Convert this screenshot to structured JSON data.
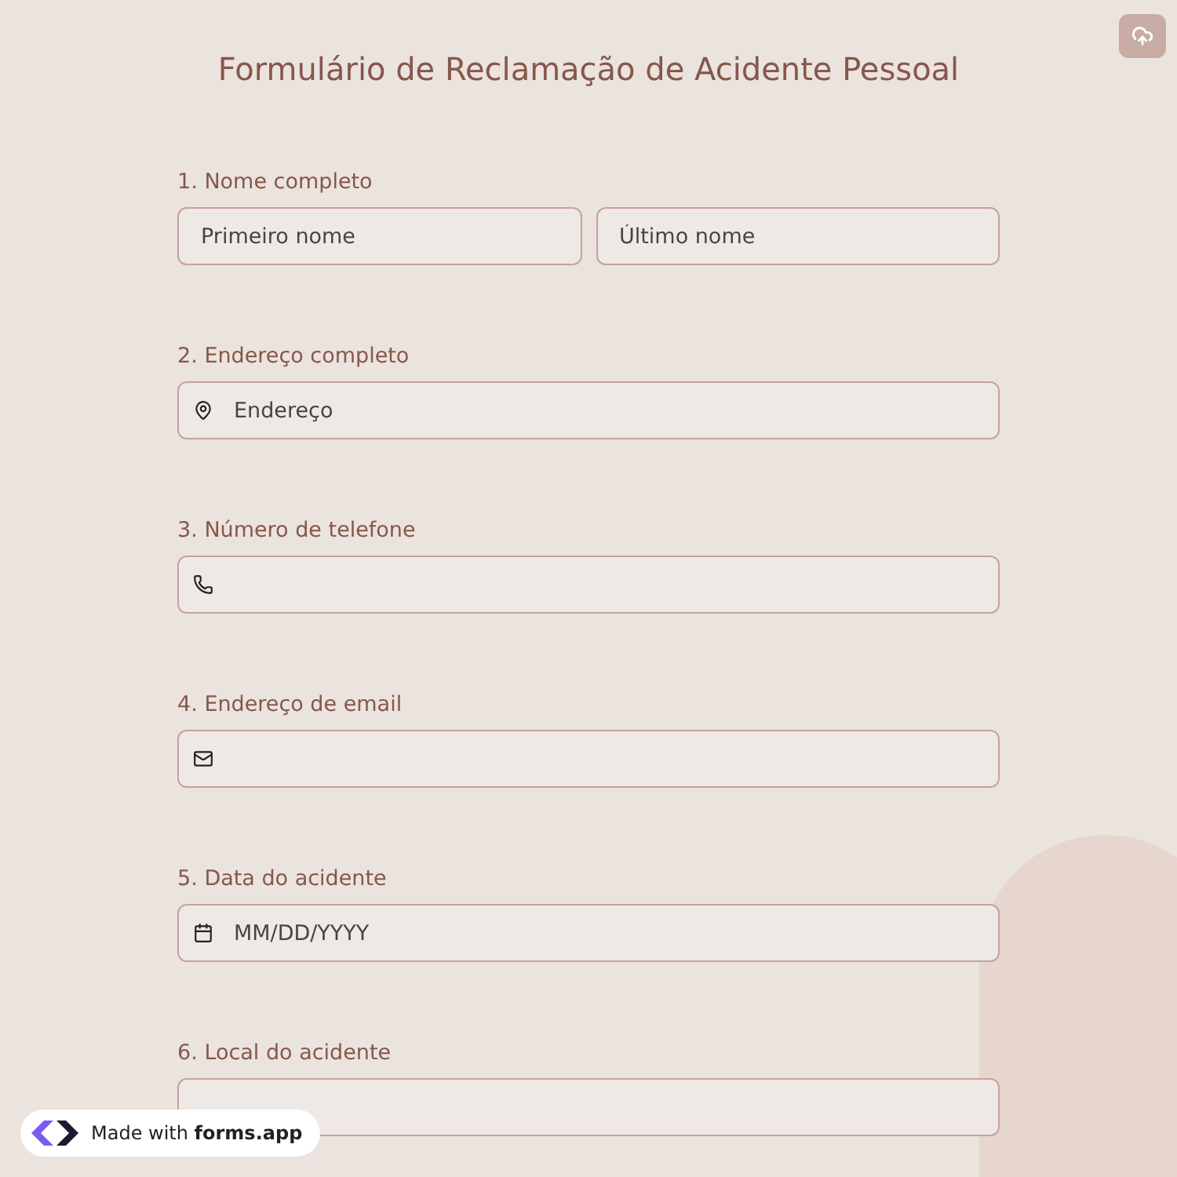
{
  "title": "Formulário de Reclamação de Acidente Pessoal",
  "questions": [
    {
      "number": "1.",
      "label": "Nome completo",
      "fields": [
        {
          "kind": "text",
          "placeholder": "Primeiro nome"
        },
        {
          "kind": "text",
          "placeholder": "Último nome"
        }
      ]
    },
    {
      "number": "2.",
      "label": "Endereço completo",
      "fields": [
        {
          "kind": "address",
          "placeholder": "Endereço"
        }
      ]
    },
    {
      "number": "3.",
      "label": "Número de telefone",
      "fields": [
        {
          "kind": "phone"
        }
      ]
    },
    {
      "number": "4.",
      "label": "Endereço de email",
      "fields": [
        {
          "kind": "email"
        }
      ]
    },
    {
      "number": "5.",
      "label": "Data do acidente",
      "fields": [
        {
          "kind": "date",
          "placeholder": "MM/DD/YYYY"
        }
      ]
    },
    {
      "number": "6.",
      "label": "Local do acidente",
      "fields": [
        {
          "kind": "text"
        }
      ]
    }
  ],
  "badge": {
    "text": "Made with **forms.app**"
  }
}
